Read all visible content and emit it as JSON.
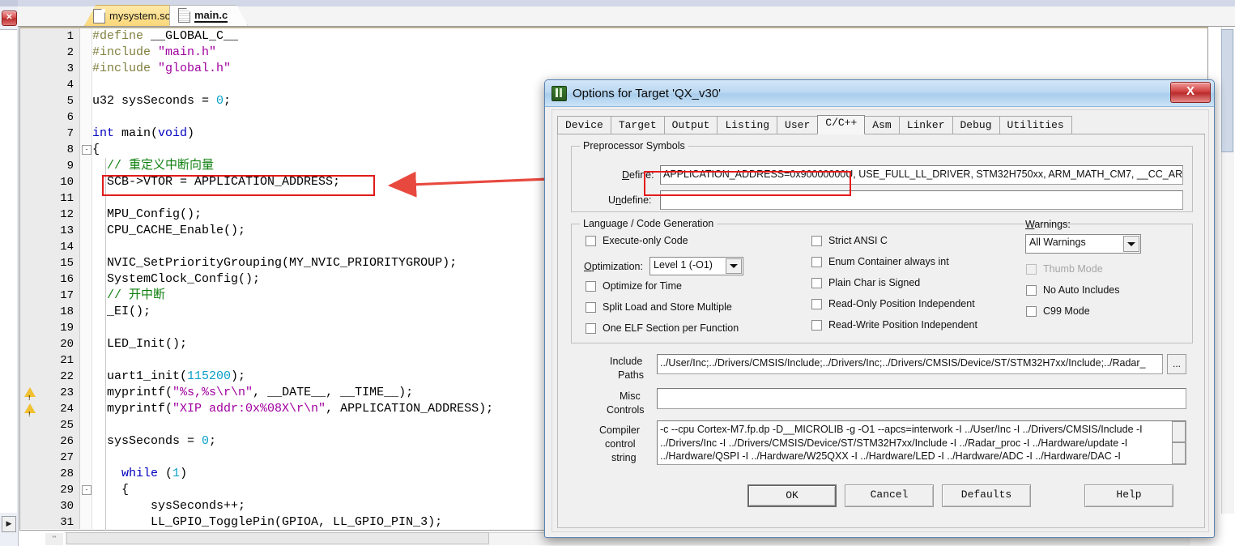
{
  "ide": {
    "close_rail_icon": "close-icon",
    "rail_arrow": "▶",
    "tabs": [
      {
        "label": "mysystem.sct",
        "active": false
      },
      {
        "label": "main.c",
        "active": true
      }
    ],
    "editor": {
      "hscroll_corner": "'''",
      "lines": [
        {
          "n": "1",
          "warn": false,
          "fold": "",
          "indent": 0,
          "tokens": [
            {
              "t": "#define",
              "c": "pre"
            },
            {
              "t": " __GLOBAL_C__",
              "c": "plain"
            }
          ]
        },
        {
          "n": "2",
          "warn": false,
          "fold": "",
          "indent": 0,
          "tokens": [
            {
              "t": "#include",
              "c": "pre"
            },
            {
              "t": " ",
              "c": "plain"
            },
            {
              "t": "\"main.h\"",
              "c": "str"
            }
          ]
        },
        {
          "n": "3",
          "warn": false,
          "fold": "",
          "indent": 0,
          "tokens": [
            {
              "t": "#include",
              "c": "pre"
            },
            {
              "t": " ",
              "c": "plain"
            },
            {
              "t": "\"global.h\"",
              "c": "str"
            }
          ]
        },
        {
          "n": "4",
          "warn": false,
          "fold": "",
          "indent": 0,
          "tokens": []
        },
        {
          "n": "5",
          "warn": false,
          "fold": "",
          "indent": 0,
          "tokens": [
            {
              "t": "u32 sysSeconds = ",
              "c": "plain"
            },
            {
              "t": "0",
              "c": "num"
            },
            {
              "t": ";",
              "c": "plain"
            }
          ]
        },
        {
          "n": "6",
          "warn": false,
          "fold": "",
          "indent": 0,
          "tokens": []
        },
        {
          "n": "7",
          "warn": false,
          "fold": "",
          "indent": 0,
          "tokens": [
            {
              "t": "int",
              "c": "kw"
            },
            {
              "t": " main(",
              "c": "plain"
            },
            {
              "t": "void",
              "c": "kw"
            },
            {
              "t": ")",
              "c": "plain"
            }
          ]
        },
        {
          "n": "8",
          "warn": false,
          "fold": "-",
          "indent": 0,
          "tokens": [
            {
              "t": "{",
              "c": "plain"
            }
          ]
        },
        {
          "n": "9",
          "warn": false,
          "fold": "",
          "indent": 1,
          "tokens": [
            {
              "t": "  // 重定义中断向量",
              "c": "cmt"
            }
          ]
        },
        {
          "n": "10",
          "warn": false,
          "fold": "",
          "indent": 1,
          "tokens": [
            {
              "t": "  SCB->VTOR = APPLICATION_ADDRESS;",
              "c": "plain"
            }
          ]
        },
        {
          "n": "11",
          "warn": false,
          "fold": "",
          "indent": 1,
          "tokens": []
        },
        {
          "n": "12",
          "warn": false,
          "fold": "",
          "indent": 1,
          "tokens": [
            {
              "t": "  MPU_Config();",
              "c": "plain"
            }
          ]
        },
        {
          "n": "13",
          "warn": false,
          "fold": "",
          "indent": 1,
          "tokens": [
            {
              "t": "  CPU_CACHE_Enable();",
              "c": "plain"
            }
          ]
        },
        {
          "n": "14",
          "warn": false,
          "fold": "",
          "indent": 1,
          "tokens": []
        },
        {
          "n": "15",
          "warn": false,
          "fold": "",
          "indent": 1,
          "tokens": [
            {
              "t": "  NVIC_SetPriorityGrouping(MY_NVIC_PRIORITYGROUP);",
              "c": "plain"
            }
          ]
        },
        {
          "n": "16",
          "warn": false,
          "fold": "",
          "indent": 1,
          "tokens": [
            {
              "t": "  SystemClock_Config();",
              "c": "plain"
            }
          ]
        },
        {
          "n": "17",
          "warn": false,
          "fold": "",
          "indent": 1,
          "tokens": [
            {
              "t": "  // 开中断",
              "c": "cmt"
            }
          ]
        },
        {
          "n": "18",
          "warn": false,
          "fold": "",
          "indent": 1,
          "tokens": [
            {
              "t": "  _EI();",
              "c": "plain"
            }
          ]
        },
        {
          "n": "19",
          "warn": false,
          "fold": "",
          "indent": 1,
          "tokens": []
        },
        {
          "n": "20",
          "warn": false,
          "fold": "",
          "indent": 1,
          "tokens": [
            {
              "t": "  LED_Init();",
              "c": "plain"
            }
          ]
        },
        {
          "n": "21",
          "warn": false,
          "fold": "",
          "indent": 1,
          "tokens": []
        },
        {
          "n": "22",
          "warn": false,
          "fold": "",
          "indent": 1,
          "tokens": [
            {
              "t": "  uart1_init(",
              "c": "plain"
            },
            {
              "t": "115200",
              "c": "num"
            },
            {
              "t": ");",
              "c": "plain"
            }
          ]
        },
        {
          "n": "23",
          "warn": true,
          "fold": "",
          "indent": 1,
          "tokens": [
            {
              "t": "  myprintf(",
              "c": "plain"
            },
            {
              "t": "\"%s,%s\\r\\n\"",
              "c": "str"
            },
            {
              "t": ", __DATE__, __TIME__);",
              "c": "plain"
            }
          ]
        },
        {
          "n": "24",
          "warn": true,
          "fold": "",
          "indent": 1,
          "tokens": [
            {
              "t": "  myprintf(",
              "c": "plain"
            },
            {
              "t": "\"XIP addr:0x%08X\\r\\n\"",
              "c": "str"
            },
            {
              "t": ", APPLICATION_ADDRESS);",
              "c": "plain"
            }
          ]
        },
        {
          "n": "25",
          "warn": false,
          "fold": "",
          "indent": 1,
          "tokens": []
        },
        {
          "n": "26",
          "warn": false,
          "fold": "",
          "indent": 1,
          "tokens": [
            {
              "t": "  sysSeconds = ",
              "c": "plain"
            },
            {
              "t": "0",
              "c": "num"
            },
            {
              "t": ";",
              "c": "plain"
            }
          ]
        },
        {
          "n": "27",
          "warn": false,
          "fold": "",
          "indent": 1,
          "tokens": []
        },
        {
          "n": "28",
          "warn": false,
          "fold": "",
          "indent": 1,
          "tokens": [
            {
              "t": "    ",
              "c": "plain"
            },
            {
              "t": "while",
              "c": "kw"
            },
            {
              "t": " (",
              "c": "plain"
            },
            {
              "t": "1",
              "c": "num"
            },
            {
              "t": ")",
              "c": "plain"
            }
          ]
        },
        {
          "n": "29",
          "warn": false,
          "fold": "-",
          "indent": 1,
          "tokens": [
            {
              "t": "    {",
              "c": "plain"
            }
          ]
        },
        {
          "n": "30",
          "warn": false,
          "fold": "",
          "indent": 1,
          "tokens": [
            {
              "t": "        sysSeconds++;",
              "c": "plain"
            }
          ]
        },
        {
          "n": "31",
          "warn": false,
          "fold": "",
          "indent": 1,
          "tokens": [
            {
              "t": "        LL_GPIO_TogglePin(GPIOA, LL_GPIO_PIN_3);",
              "c": "plain"
            }
          ]
        }
      ]
    }
  },
  "dialog": {
    "title": "Options for Target 'QX_v30'",
    "close_label": "X",
    "app_icon": "keil-uvision-icon",
    "tabs": [
      {
        "label": "Device",
        "selected": false
      },
      {
        "label": "Target",
        "selected": false
      },
      {
        "label": "Output",
        "selected": false
      },
      {
        "label": "Listing",
        "selected": false
      },
      {
        "label": "User",
        "selected": false
      },
      {
        "label": "C/C++",
        "selected": true
      },
      {
        "label": "Asm",
        "selected": false
      },
      {
        "label": "Linker",
        "selected": false
      },
      {
        "label": "Debug",
        "selected": false
      },
      {
        "label": "Utilities",
        "selected": false
      }
    ],
    "preprocessor": {
      "group_title": "Preprocessor Symbols",
      "define_label": "Define:",
      "define_value": "APPLICATION_ADDRESS=0x90000000U, USE_FULL_LL_DRIVER, STM32H750xx, ARM_MATH_CM7, __CC_AR",
      "undefine_label": "Undefine:",
      "undefine_value": ""
    },
    "language": {
      "group_title": "Language / Code Generation",
      "col1": [
        {
          "label": "Execute-only Code",
          "checked": false,
          "disabled": false
        },
        {
          "label": "Optimize for Time",
          "checked": false,
          "disabled": false
        },
        {
          "label": "Split Load and Store Multiple",
          "checked": false,
          "disabled": false
        },
        {
          "label": "One ELF Section per Function",
          "checked": false,
          "disabled": false
        }
      ],
      "optimization_label": "Optimization:",
      "optimization_value": "Level 1 (-O1)",
      "col2": [
        {
          "label": "Strict ANSI C",
          "checked": false,
          "disabled": false
        },
        {
          "label": "Enum Container always int",
          "checked": false,
          "disabled": false
        },
        {
          "label": "Plain Char is Signed",
          "checked": false,
          "disabled": false
        },
        {
          "label": "Read-Only Position Independent",
          "checked": false,
          "disabled": false
        },
        {
          "label": "Read-Write Position Independent",
          "checked": false,
          "disabled": false
        }
      ],
      "warnings_label": "Warnings:",
      "warnings_value": "All Warnings",
      "col3": [
        {
          "label": "Thumb Mode",
          "checked": false,
          "disabled": true
        },
        {
          "label": "No Auto Includes",
          "checked": false,
          "disabled": false
        },
        {
          "label": "C99 Mode",
          "checked": false,
          "disabled": false
        }
      ]
    },
    "paths": {
      "include_label_1": "Include",
      "include_label_2": "Paths",
      "include_value": "../User/Inc;../Drivers/CMSIS/Include;../Drivers/Inc;../Drivers/CMSIS/Device/ST/STM32H7xx/Include;../Radar_",
      "browse_label": "...",
      "misc_label_1": "Misc",
      "misc_label_2": "Controls",
      "misc_value": "",
      "compiler_label_1": "Compiler",
      "compiler_label_2": "control",
      "compiler_label_3": "string",
      "compiler_value": "-c --cpu Cortex-M7.fp.dp -D__MICROLIB -g -O1 --apcs=interwork -I ../User/Inc -I ../Drivers/CMSIS/Include -I ../Drivers/Inc -I ../Drivers/CMSIS/Device/ST/STM32H7xx/Include -I ../Radar_proc -I ../Hardware/update -I ../Hardware/QSPI -I ../Hardware/W25QXX -I ../Hardware/LED -I ../Hardware/ADC -I ../Hardware/DAC -I"
    },
    "buttons": {
      "ok": "OK",
      "cancel": "Cancel",
      "defaults": "Defaults",
      "help": "Help"
    }
  },
  "annotations": {
    "arrow_color": "#e8493f",
    "highlight_color": "#e41c1c"
  }
}
